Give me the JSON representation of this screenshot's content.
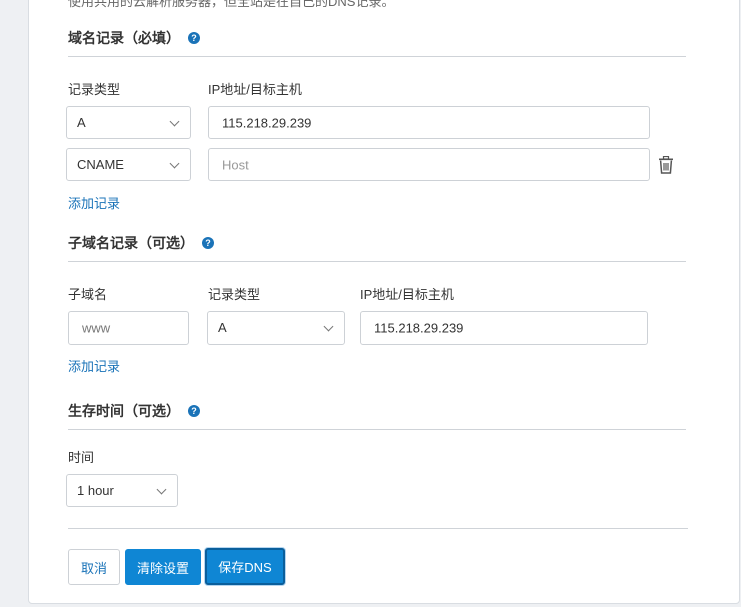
{
  "top_note": "使用共用的云解析服务器，但全站是在自己的DNS记录。",
  "domain_records": {
    "title": "域名记录（必填）",
    "col_type": "记录类型",
    "col_host": "IP地址/目标主机",
    "rows": [
      {
        "type": "A",
        "value": "115.218.29.239",
        "placeholder": ""
      },
      {
        "type": "CNAME",
        "value": "",
        "placeholder": "Host"
      }
    ],
    "add_link": "添加记录"
  },
  "subdomain_records": {
    "title": "子域名记录（可选）",
    "col_sub": "子域名",
    "col_type": "记录类型",
    "col_host": "IP地址/目标主机",
    "row": {
      "subdomain": "www",
      "type": "A",
      "value": "115.218.29.239"
    },
    "add_link": "添加记录"
  },
  "ttl": {
    "title": "生存时间（可选）",
    "label": "时间",
    "value": "1 hour"
  },
  "help_glyph": "?",
  "buttons": {
    "cancel": "取消",
    "clear": "清除设置",
    "save": "保存DNS"
  },
  "colors": {
    "accent": "#0f86d4",
    "link": "#1a73b8",
    "background": "#eef0f3"
  }
}
